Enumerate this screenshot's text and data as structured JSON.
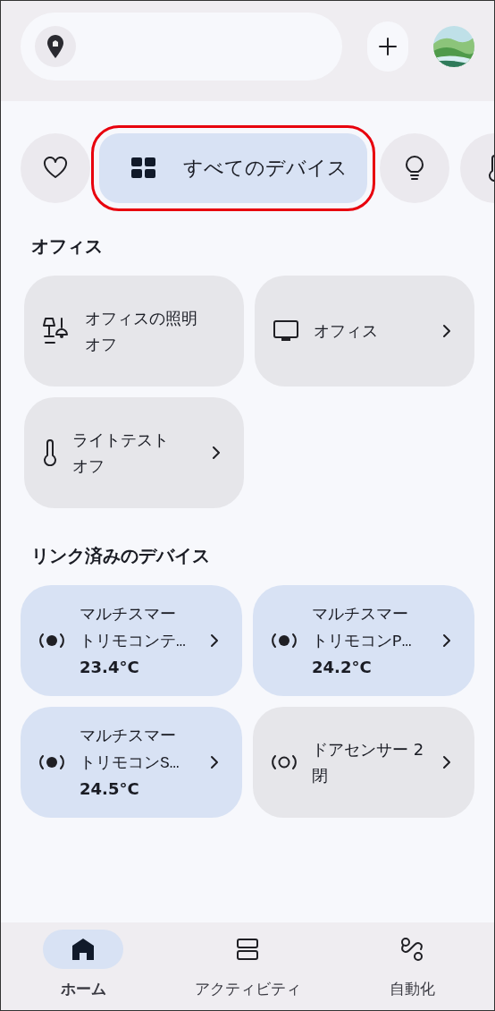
{
  "filter_chips": [
    {
      "selected": false,
      "highlighted": false
    },
    {
      "label": "すべてのデバイス",
      "selected": true,
      "highlighted": true
    },
    {
      "selected": false,
      "highlighted": false
    },
    {
      "selected": false,
      "highlighted": false
    }
  ],
  "sections": [
    {
      "title": "オフィス",
      "cards": [
        {
          "title": "オフィスの照明",
          "status": "オフ",
          "chevron": false,
          "active": false
        },
        {
          "title": "オフィス",
          "chevron": true,
          "active": false
        },
        {
          "title": "ライトテスト",
          "status": "オフ",
          "chevron": true,
          "active": false
        }
      ]
    },
    {
      "title": "リンク済みのデバイス",
      "cards": [
        {
          "title": "マルチスマートリモコンテ…",
          "status": "23.4°C",
          "chevron": true,
          "active": true
        },
        {
          "title": "マルチスマートリモコンP…",
          "status": "24.2°C",
          "chevron": true,
          "active": true
        },
        {
          "title": "マルチスマートリモコンS…",
          "status": "24.5°C",
          "chevron": true,
          "active": true
        },
        {
          "title": "ドアセンサー 2",
          "status": "閉",
          "chevron": true,
          "active": false
        }
      ]
    }
  ],
  "bottom_nav": [
    {
      "label": "ホーム",
      "selected": true
    },
    {
      "label": "アクティビティ",
      "selected": false
    },
    {
      "label": "自動化",
      "selected": false
    }
  ]
}
